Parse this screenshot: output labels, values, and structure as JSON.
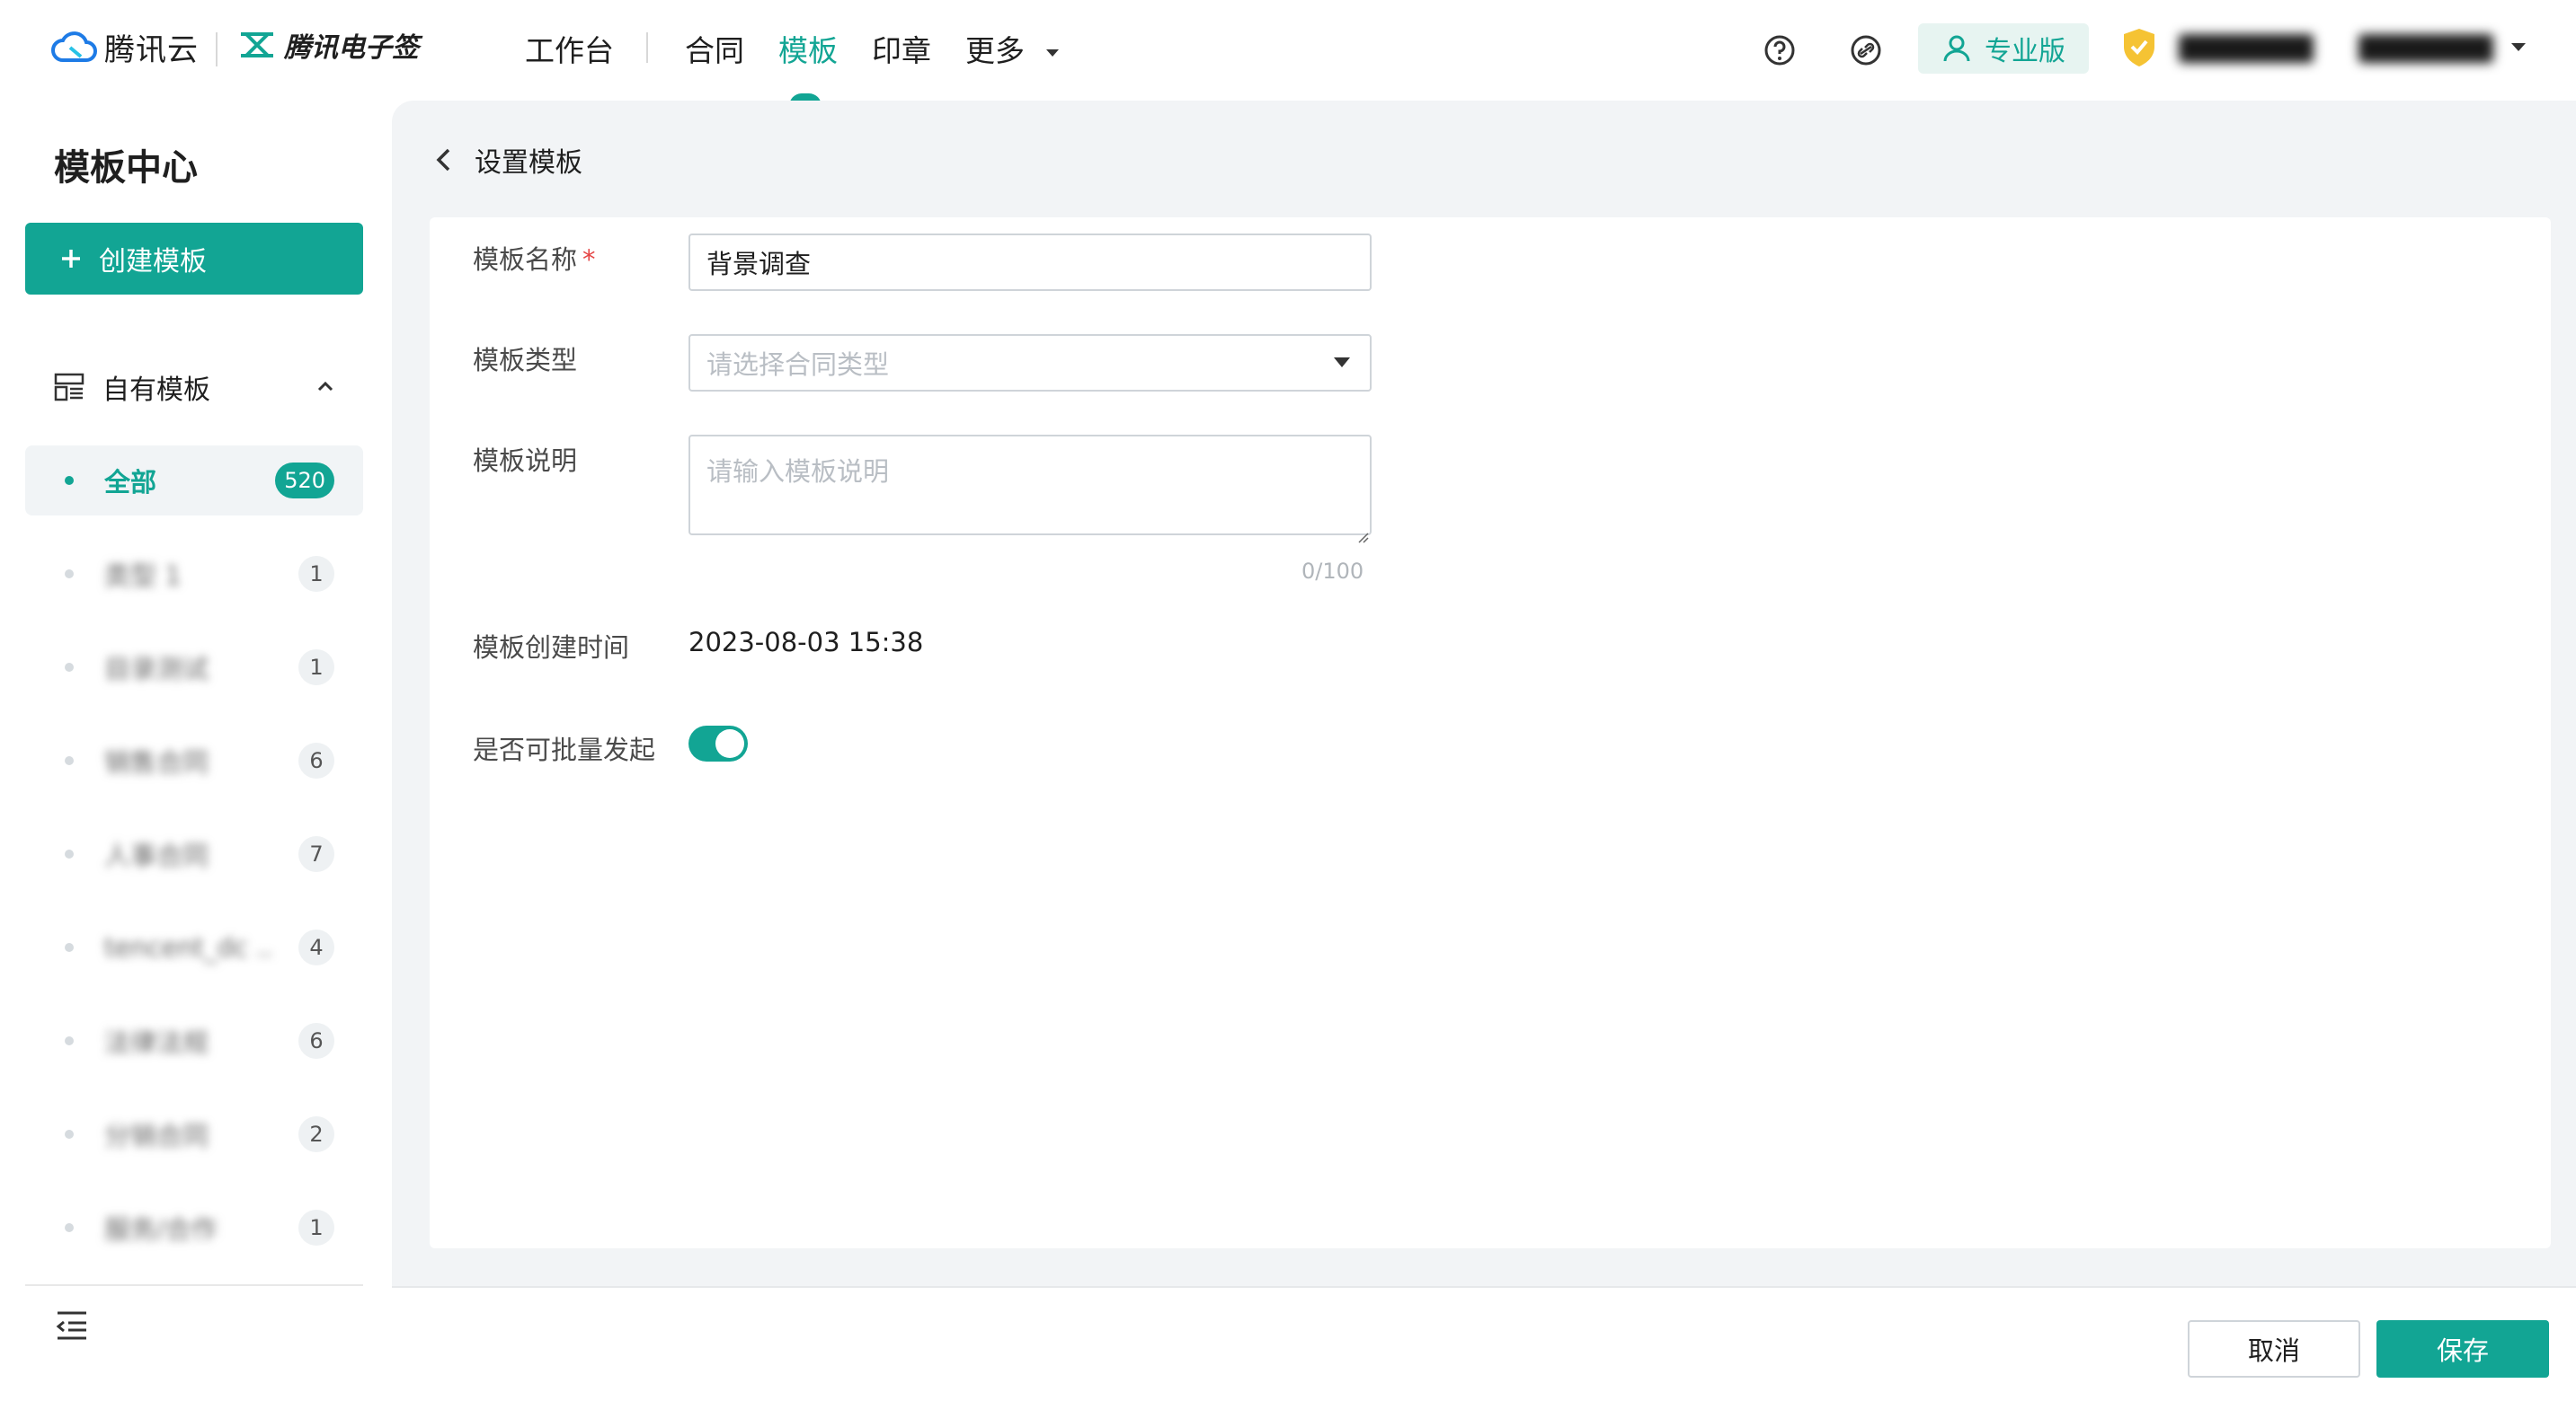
{
  "topbar": {
    "brand_cloud": "腾讯云",
    "brand_product": "腾讯电子签",
    "nav": [
      {
        "label": "工作台"
      },
      {
        "label": "合同"
      },
      {
        "label": "模板"
      },
      {
        "label": "印章"
      },
      {
        "label": "更多"
      }
    ],
    "active_nav": "模板",
    "edition_label": "专业版",
    "icons": [
      "help-icon",
      "link-icon",
      "user-icon",
      "shield-icon",
      "chevron-down-icon"
    ]
  },
  "sidebar": {
    "title": "模板中心",
    "create_label": "创建模板",
    "group_label": "自有模板",
    "categories": [
      {
        "name": "全部",
        "count": "520",
        "active": true
      },
      {
        "name": "类型 1",
        "count": "1"
      },
      {
        "name": "目录测试",
        "count": "1"
      },
      {
        "name": "销售合同",
        "count": "6"
      },
      {
        "name": "人事合同",
        "count": "7"
      },
      {
        "name": "tencent_dc ..",
        "count": "4"
      },
      {
        "name": "法律法规",
        "count": "6"
      },
      {
        "name": "分销合同",
        "count": "2"
      },
      {
        "name": "服务/合作",
        "count": "1"
      }
    ]
  },
  "main": {
    "back_label": "设置模板",
    "form": {
      "name_label": "模板名称",
      "required_mark": "*",
      "name_value": "背景调查",
      "type_label": "模板类型",
      "type_placeholder": "请选择合同类型",
      "desc_label": "模板说明",
      "desc_placeholder": "请输入模板说明",
      "desc_counter": "0/100",
      "created_label": "模板创建时间",
      "created_value": "2023-08-03 15:38",
      "batch_label": "是否可批量发起",
      "batch_enabled": true
    },
    "footer": {
      "cancel_label": "取消",
      "save_label": "保存"
    }
  },
  "colors": {
    "accent": "#12a594",
    "background": "#f2f4f6"
  }
}
